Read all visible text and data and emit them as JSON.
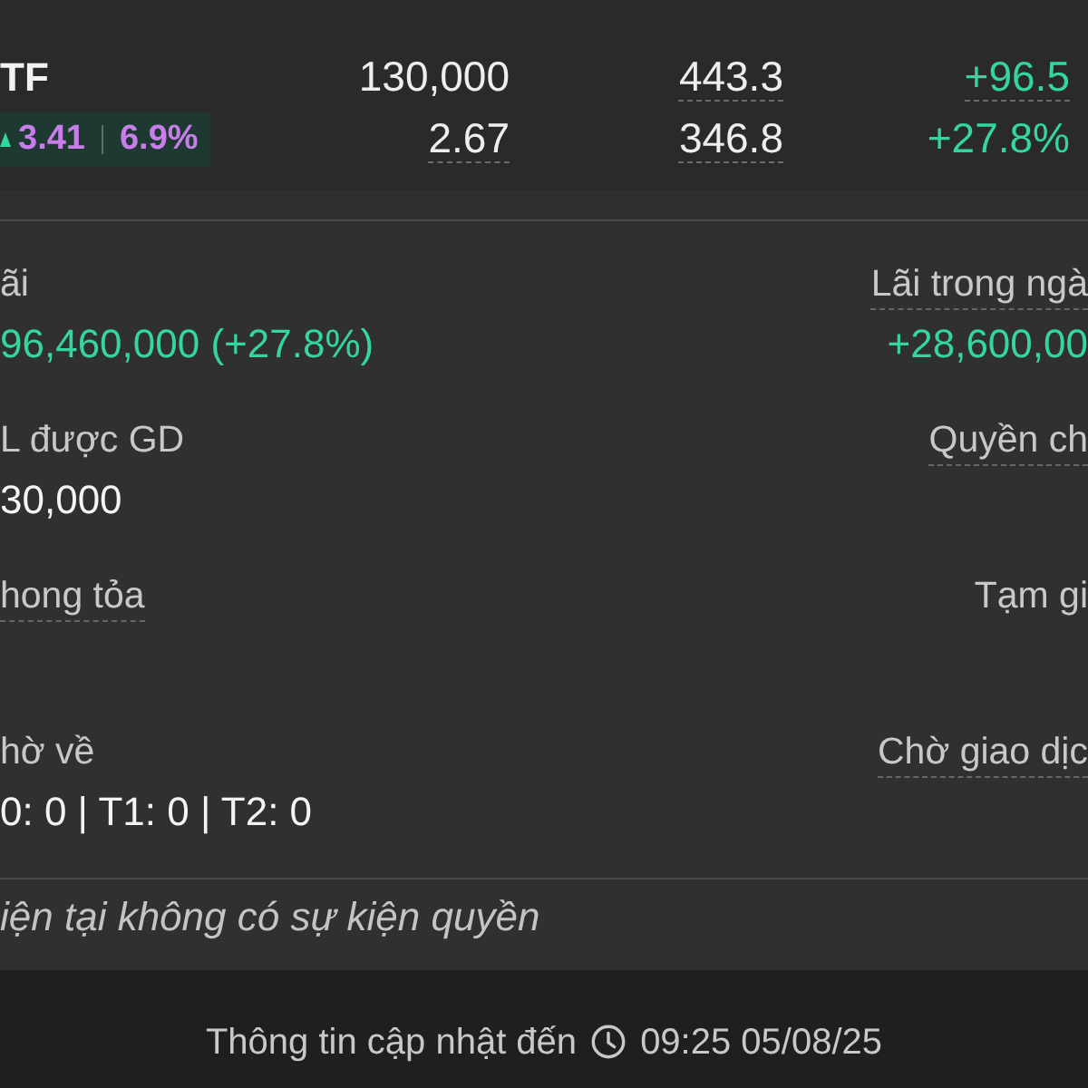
{
  "summary": {
    "symbol": "TF",
    "change": {
      "rising": true,
      "value": "3.41",
      "percent": "6.9%"
    },
    "figure_rows": [
      {
        "cells": [
          {
            "text": "130,000",
            "kind": "plain",
            "underlined": false
          },
          {
            "text": "443.3",
            "kind": "plain",
            "underlined": true
          },
          {
            "text": "+96.5",
            "kind": "gain",
            "underlined": true
          }
        ]
      },
      {
        "cells": [
          {
            "text": "2.67",
            "kind": "plain",
            "underlined": true
          },
          {
            "text": "346.8",
            "kind": "plain",
            "underlined": true
          },
          {
            "text": "+27.8%",
            "kind": "gain",
            "underlined": false
          }
        ]
      }
    ]
  },
  "details": {
    "rows": [
      {
        "left": {
          "label": "ãi",
          "underlined": false,
          "value": "96,460,000 (+27.8%)",
          "kind": "gain"
        },
        "right": {
          "label": "Lãi trong ngà",
          "underlined": true,
          "value": "+28,600,00",
          "kind": "gain"
        }
      },
      {
        "left": {
          "label": "L được GD",
          "underlined": false,
          "value": "30,000",
          "kind": "plain"
        },
        "right": {
          "label": "Quyền ch",
          "underlined": true
        }
      },
      {
        "left": {
          "label": "hong tỏa",
          "underlined": true
        },
        "right": {
          "label": "Tạm gi",
          "underlined": false
        }
      },
      {
        "left": {
          "label": "hờ về",
          "underlined": false,
          "value": "0: 0 | T1: 0 | T2: 0",
          "kind": "plain"
        },
        "right": {
          "label": "Chờ giao dịc",
          "underlined": true
        }
      }
    ]
  },
  "events": {
    "message": "iện tại không có sự kiện quyền"
  },
  "footer": {
    "label": "Thông tin cập nhật đến",
    "timestamp": "09:25 05/08/25"
  }
}
